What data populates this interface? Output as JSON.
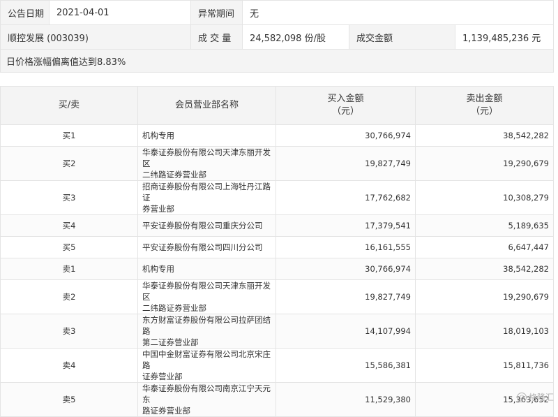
{
  "summary": {
    "announce_label": "公告日期",
    "announce_date": "2021-04-01",
    "abnormal_label": "异常期间",
    "abnormal_value": "无",
    "stock_name": "顺控发展 (003039)",
    "volume_label": "成 交 量",
    "volume_value": "24,582,098 份/股",
    "amount_label": "成交金额",
    "amount_value": "1,139,485,236 元",
    "reason": "日价格涨幅偏离值达到8.83%"
  },
  "table": {
    "headers": {
      "side": "买/卖",
      "name": "会员营业部名称",
      "buy_line1": "买入金额",
      "buy_line2": "（元）",
      "sell_line1": "卖出金额",
      "sell_line2": "（元）"
    },
    "rows": [
      {
        "side": "买1",
        "name1": "机构专用",
        "name2": "",
        "buy": "30,766,974",
        "sell": "38,542,282"
      },
      {
        "side": "买2",
        "name1": "华泰证券股份有限公司天津东丽开发区",
        "name2": "二纬路证券营业部",
        "buy": "19,827,749",
        "sell": "19,290,679"
      },
      {
        "side": "买3",
        "name1": "招商证券股份有限公司上海牡丹江路证",
        "name2": "券营业部",
        "buy": "17,762,682",
        "sell": "10,308,279"
      },
      {
        "side": "买4",
        "name1": "平安证券股份有限公司重庆分公司",
        "name2": "",
        "buy": "17,379,541",
        "sell": "5,189,635"
      },
      {
        "side": "买5",
        "name1": "平安证券股份有限公司四川分公司",
        "name2": "",
        "buy": "16,161,555",
        "sell": "6,647,447"
      },
      {
        "side": "卖1",
        "name1": "机构专用",
        "name2": "",
        "buy": "30,766,974",
        "sell": "38,542,282"
      },
      {
        "side": "卖2",
        "name1": "华泰证券股份有限公司天津东丽开发区",
        "name2": "二纬路证券营业部",
        "buy": "19,827,749",
        "sell": "19,290,679"
      },
      {
        "side": "卖3",
        "name1": "东方财富证券股份有限公司拉萨团结路",
        "name2": "第二证券营业部",
        "buy": "14,107,994",
        "sell": "18,019,103"
      },
      {
        "side": "卖4",
        "name1": "中国中金财富证券有限公司北京宋庄路",
        "name2": "证券营业部",
        "buy": "15,586,381",
        "sell": "15,811,736"
      },
      {
        "side": "卖5",
        "name1": "华泰证券股份有限公司南京江宁天元东",
        "name2": "路证券营业部",
        "buy": "11,529,380",
        "sell": "15,363,652"
      }
    ]
  },
  "watermark": {
    "icon": "G",
    "text": "格隆汇"
  }
}
